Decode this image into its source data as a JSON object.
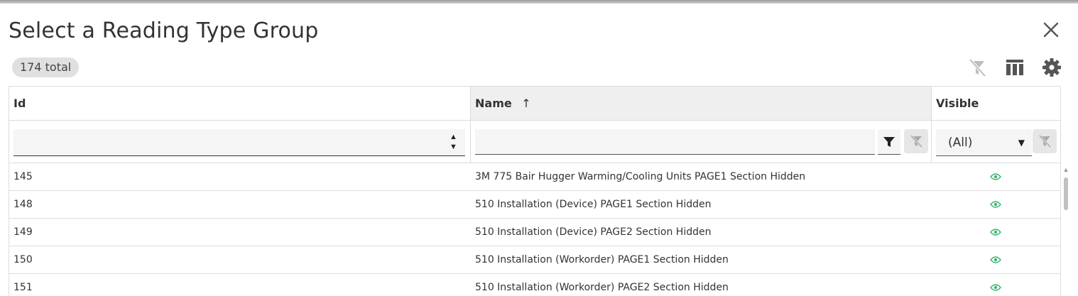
{
  "dialog": {
    "title": "Select a Reading Type Group",
    "total_badge": "174 total"
  },
  "toolbar": {
    "icons": [
      "filter-off-icon",
      "columns-icon",
      "gear-icon"
    ]
  },
  "grid": {
    "columns": [
      {
        "label": "Id"
      },
      {
        "label": "Name",
        "sort": "ascending",
        "sort_icon": "↑"
      },
      {
        "label": "Visible"
      }
    ],
    "filters": {
      "id_value": "",
      "name_value": "",
      "visible_selected": "(All)"
    },
    "rows": [
      {
        "id": "145",
        "name": "3M 775 Bair Hugger Warming/Cooling Units PAGE1 Section Hidden",
        "visible_icon": "eye-icon"
      },
      {
        "id": "148",
        "name": "510 Installation (Device) PAGE1 Section Hidden",
        "visible_icon": "eye-icon"
      },
      {
        "id": "149",
        "name": "510 Installation (Device) PAGE2 Section Hidden",
        "visible_icon": "eye-icon"
      },
      {
        "id": "150",
        "name": "510 Installation (Workorder) PAGE1 Section Hidden",
        "visible_icon": "eye-icon"
      },
      {
        "id": "151",
        "name": "510 Installation (Workorder) PAGE2 Section Hidden",
        "visible_icon": "eye-icon"
      }
    ]
  },
  "colors": {
    "accent_green": "#3cb371",
    "badge_bg": "#e0e0e0",
    "border": "#dcdcdc"
  }
}
